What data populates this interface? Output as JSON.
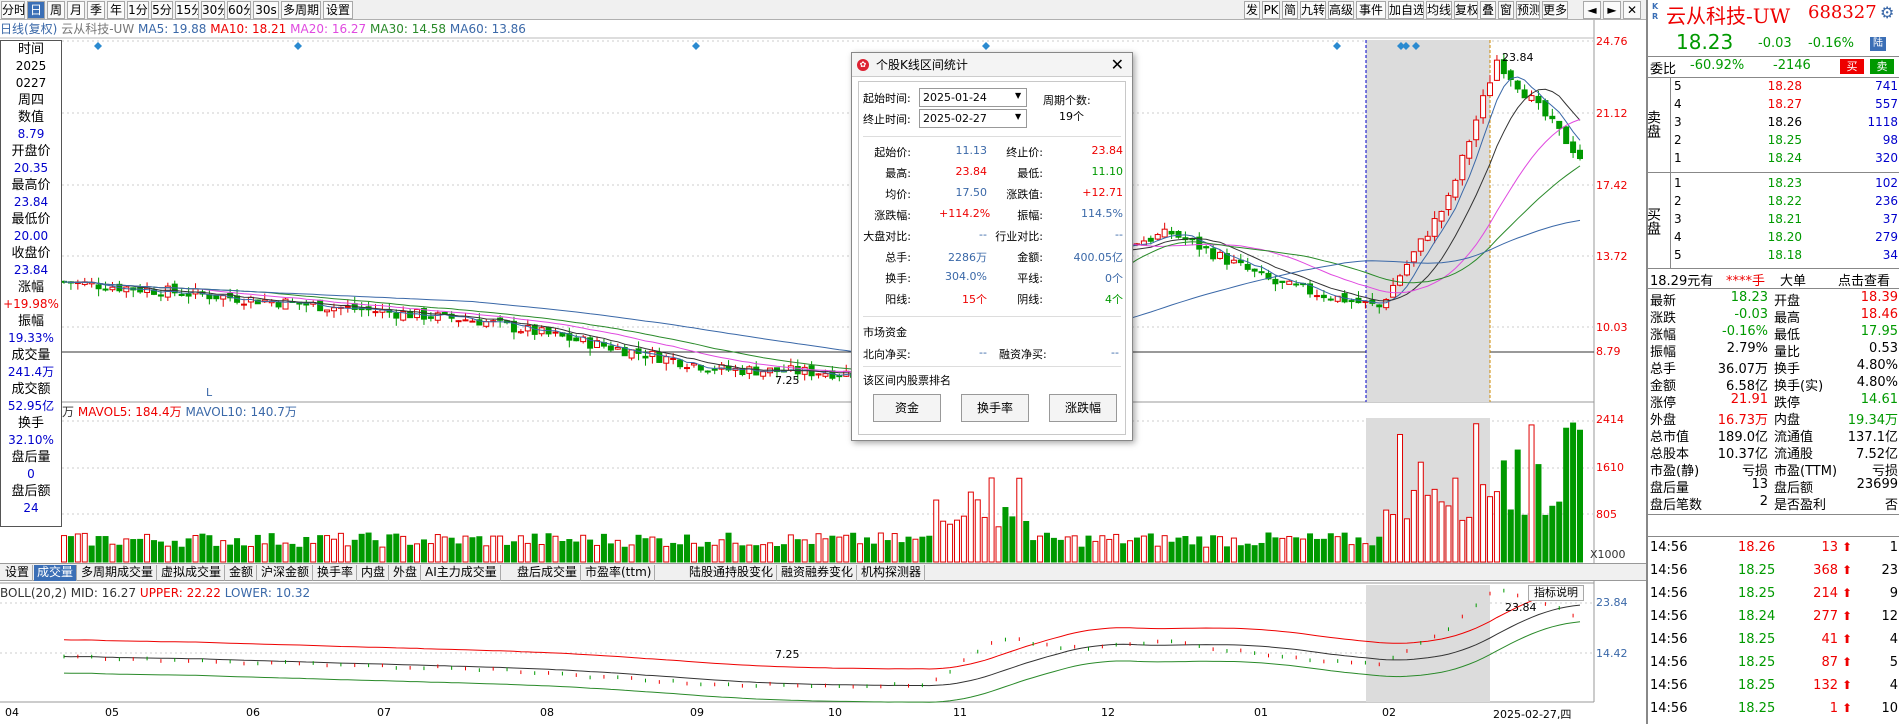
{
  "toolbar": {
    "left": [
      "分时",
      "日",
      "周",
      "月",
      "季",
      "年",
      "1分",
      "5分",
      "15分",
      "30分",
      "60分",
      "30s",
      "多周期",
      "设置"
    ],
    "right": [
      "发",
      "PK",
      "简",
      "九转",
      "高级",
      "事件",
      "加自选",
      "均线",
      "复权",
      "叠",
      "窗",
      "预测",
      "更多"
    ]
  },
  "info_line": {
    "prefix": "日线(复权)",
    "name": "云从科技-UW",
    "ma5": "MA5: 19.88",
    "ma10": "MA10: 18.21",
    "ma20": "MA20: 16.27",
    "ma30": "MA30: 14.58",
    "ma60": "MA60: 13.86"
  },
  "sidebar": [
    {
      "k": "时间",
      "v": "2025"
    },
    {
      "k": "",
      "v": "0227"
    },
    {
      "k": "周四",
      "v": ""
    },
    {
      "k": "数值",
      "v": "8.79"
    },
    {
      "k": "开盘价",
      "v": "20.35"
    },
    {
      "k": "最高价",
      "v": "23.84"
    },
    {
      "k": "最低价",
      "v": "20.00"
    },
    {
      "k": "收盘价",
      "v": "23.84"
    },
    {
      "k": "涨幅",
      "v": "+19.98%"
    },
    {
      "k": "振幅",
      "v": "19.33%"
    },
    {
      "k": "成交量",
      "v": "241.4万"
    },
    {
      "k": "成交额",
      "v": "52.95亿"
    },
    {
      "k": "换手",
      "v": "32.10%"
    },
    {
      "k": "盘后量",
      "v": "0"
    },
    {
      "k": "盘后额",
      "v": "24"
    }
  ],
  "price_axis": [
    "24.76",
    "21.12",
    "17.42",
    "13.72",
    "10.03",
    "8.79"
  ],
  "price_labels": {
    "high": "23.84",
    "low": "7.25",
    "marker": "L"
  },
  "vol_header": {
    "unit": "万",
    "mavol5": "MAVOL5: 184.4万",
    "mavol10": "MAVOL10: 140.7万"
  },
  "vol_axis": [
    "2414",
    "1610",
    "805",
    "X1000"
  ],
  "tabs": [
    "设置",
    "成交量",
    "多周期成交量",
    "虚拟成交量",
    "金额",
    "沪深金额",
    "换手率",
    "内盘",
    "外盘",
    "AI主力成交量",
    "盘后成交量",
    "市盈率(ttm)",
    "陆股通持股变化",
    "融资融券变化",
    "机构探测器"
  ],
  "boll": {
    "header": "BOLL(20,2) MID: 16.27",
    "upper": "UPPER: 22.22",
    "lower": "LOWER: 10.32",
    "axis": [
      "23.84",
      "14.42"
    ],
    "high": "23.84",
    "low": "7.25",
    "button": "指标说明"
  },
  "x_axis": [
    "04",
    "05",
    "06",
    "07",
    "08",
    "09",
    "10",
    "11",
    "12",
    "01",
    "02",
    "2025-02-27,四"
  ],
  "dialog": {
    "title": "个股K线区间统计",
    "start_label": "起始时间:",
    "start": "2025-01-24",
    "end_label": "终止时间:",
    "end": "2025-02-27",
    "period_label": "周期个数:",
    "period": "19个",
    "rows": [
      [
        "起始价:",
        "11.13",
        "终止价:",
        "23.84"
      ],
      [
        "最高:",
        "23.84",
        "最低:",
        "11.10"
      ],
      [
        "均价:",
        "17.50",
        "涨跌值:",
        "+12.71"
      ],
      [
        "涨跌幅:",
        "+114.2%",
        "振幅:",
        "114.5%"
      ],
      [
        "大盘对比:",
        "--",
        "行业对比:",
        "--"
      ],
      [
        "总手:",
        "2286万",
        "金额:",
        "400.05亿"
      ],
      [
        "换手:",
        "304.0%",
        "平线:",
        "0个"
      ],
      [
        "阳线:",
        "15个",
        "阴线:",
        "4个"
      ]
    ],
    "fund_title": "市场资金",
    "north_label": "北向净买:",
    "north": "--",
    "margin_label": "融资净买:",
    "margin": "--",
    "rank_title": "该区间内股票排名",
    "buttons": [
      "资金",
      "换手率",
      "涨跌幅"
    ]
  },
  "quote": {
    "name": "云从科技-UW",
    "code": "688327",
    "price": "18.23",
    "change": "-0.03",
    "pct": "-0.16%",
    "webi_label": "委比",
    "webi": "-60.92%",
    "weicha": "-2146",
    "buy_btn": "买",
    "sell_btn": "卖",
    "sell": [
      [
        "5",
        "18.28",
        "741"
      ],
      [
        "4",
        "18.27",
        "557"
      ],
      [
        "3",
        "18.26",
        "1118"
      ],
      [
        "2",
        "18.25",
        "98"
      ],
      [
        "1",
        "18.24",
        "320"
      ]
    ],
    "buy": [
      [
        "1",
        "18.23",
        "102"
      ],
      [
        "2",
        "18.22",
        "236"
      ],
      [
        "3",
        "18.21",
        "37"
      ],
      [
        "4",
        "18.20",
        "279"
      ],
      [
        "5",
        "18.18",
        "34"
      ]
    ],
    "sell_side": "卖盘",
    "buy_side": "买盘",
    "banner": [
      "18.29元有",
      "****手",
      "大单",
      "点击查看"
    ],
    "stats": [
      [
        "最新",
        "18.23",
        "开盘",
        "18.39"
      ],
      [
        "涨跌",
        "-0.03",
        "最高",
        "18.46"
      ],
      [
        "涨幅",
        "-0.16%",
        "最低",
        "17.95"
      ],
      [
        "振幅",
        "2.79%",
        "量比",
        "0.53"
      ],
      [
        "总手",
        "36.07万",
        "换手",
        "4.80%"
      ],
      [
        "金额",
        "6.58亿",
        "换手(实)",
        "4.80%"
      ],
      [
        "涨停",
        "21.91",
        "跌停",
        "14.61"
      ],
      [
        "外盘",
        "16.73万",
        "内盘",
        "19.34万"
      ],
      [
        "总市值",
        "189.0亿",
        "流通值",
        "137.1亿"
      ],
      [
        "总股本",
        "10.37亿",
        "流通股",
        "7.52亿"
      ],
      [
        "市盈(静)",
        "亏损",
        "市盈(TTM)",
        "亏损"
      ],
      [
        "盘后量",
        "13",
        "盘后额",
        "23699"
      ],
      [
        "盘后笔数",
        "2",
        "是否盈利",
        "否"
      ]
    ],
    "ticks": [
      [
        "14:56",
        "18.26",
        "13",
        "1"
      ],
      [
        "14:56",
        "18.25",
        "368",
        "23"
      ],
      [
        "14:56",
        "18.25",
        "214",
        "9"
      ],
      [
        "14:56",
        "18.24",
        "277",
        "12"
      ],
      [
        "14:56",
        "18.25",
        "41",
        "4"
      ],
      [
        "14:56",
        "18.25",
        "87",
        "5"
      ],
      [
        "14:56",
        "18.25",
        "132",
        "4"
      ],
      [
        "14:56",
        "18.25",
        "1",
        "10"
      ]
    ]
  },
  "colors": {
    "up": "#e00000",
    "down": "#009900",
    "accent": "#3b6fb6",
    "ma_pink": "#e04ae0",
    "ma_green": "#2a8a2a",
    "ma_blue": "#3a68a8"
  }
}
